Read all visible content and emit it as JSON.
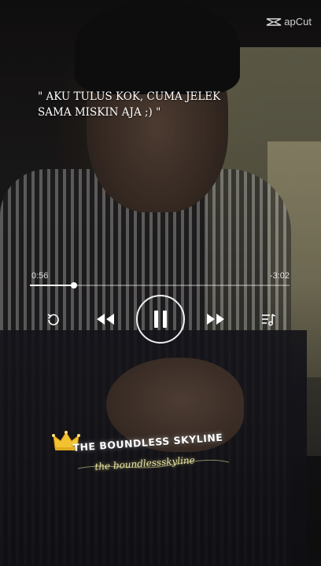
{
  "watermark": {
    "text": "apCut",
    "icon": "capcut-logo-icon"
  },
  "quote": {
    "line1": "\" AKU TULUS KOK, CUMA JELEK",
    "line2": "SAMA MISKIN AJA ;) \""
  },
  "player": {
    "elapsed": "0:56",
    "remaining": "-3:02",
    "progress": 0.17,
    "controls": {
      "repeat_icon": "repeat-icon",
      "previous_icon": "rewind-icon",
      "play_pause_icon": "pause-icon",
      "next_icon": "fast-forward-icon",
      "queue_icon": "playlist-icon"
    }
  },
  "logo": {
    "title": "THE BOUNDLESS SKYLINE",
    "subtitle": "the boundlessskyline",
    "icon": "crown-icon"
  },
  "colors": {
    "text": "#ffffff",
    "subtitle_glow": "#e7e3a0",
    "crown": "#f2c230"
  }
}
